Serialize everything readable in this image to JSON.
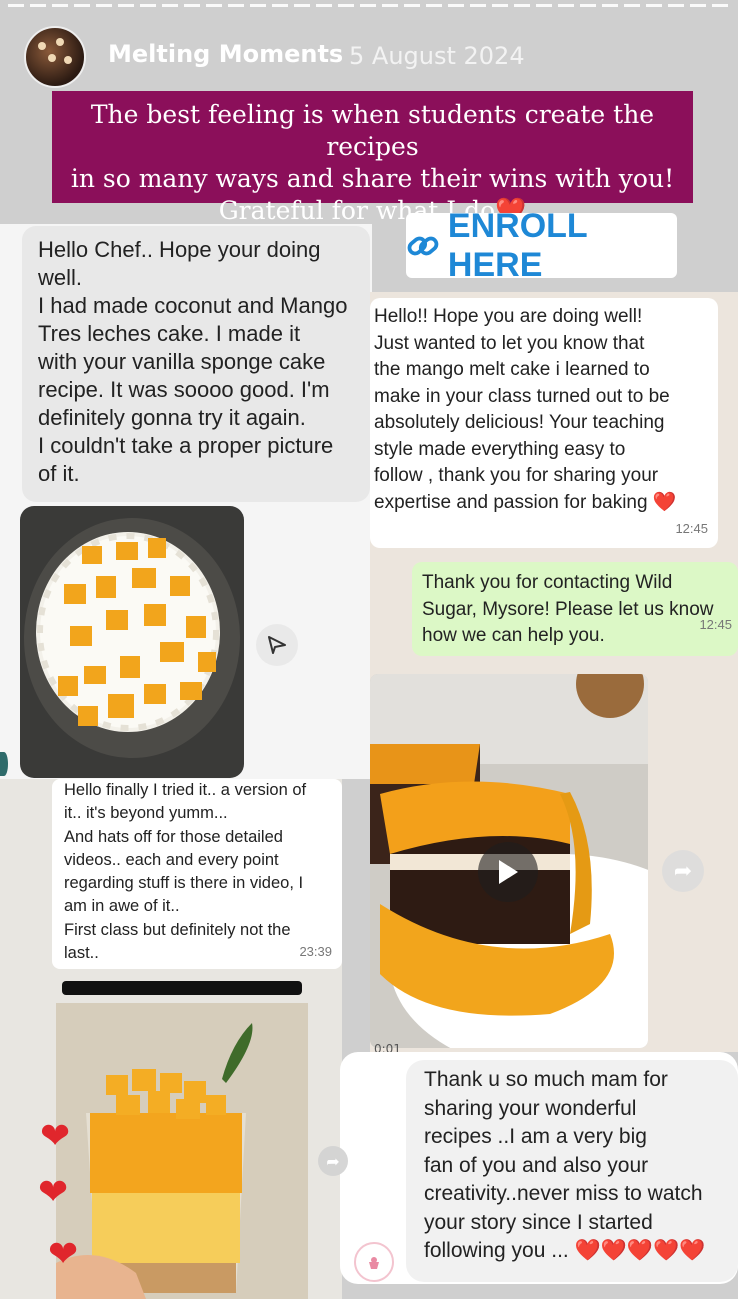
{
  "story": {
    "account_name": "Melting Moments",
    "date": "5 August 2024",
    "banner_lines": [
      "The best feeling is when students create the recipes",
      "in so many ways and share their wins with you!",
      "Grateful for what I do"
    ],
    "banner_heart": "❤️"
  },
  "enroll": {
    "label": "ENROLL HERE",
    "icon": "link-icon"
  },
  "messages": {
    "chef_msg": [
      "Hello Chef.. Hope your doing",
      "well.",
      "I had made coconut and Mango",
      "Tres leches cake. I made it",
      "with your vanilla sponge cake",
      "recipe. It was soooo good. I'm",
      "definitely gonna try it again.",
      "I couldn't take a proper picture",
      "of it."
    ],
    "mango_melt_msg": [
      "Hello!! Hope you are doing well!",
      "Just wanted to let you know that",
      "the mango melt cake i learned to",
      "make in your class turned out to be",
      "absolutely delicious! Your teaching",
      "style made everything easy to",
      "follow , thank you for sharing your",
      "expertise and passion for baking ❤️"
    ],
    "mango_melt_time": "12:45",
    "auto_reply": [
      "Thank you for contacting Wild",
      "Sugar, Mysore! Please let us know",
      "how we can help you."
    ],
    "auto_reply_time": "12:45",
    "tried_msg": [
      "Hello finally I tried it.. a version of",
      "it.. it's beyond yumm...",
      "And hats off for those detailed",
      "videos.. each and every point",
      "regarding stuff is there in video,  I",
      "am in awe of it..",
      "First class but definitely not the",
      "last.."
    ],
    "tried_time": "23:39",
    "fan_msg": [
      "Thank u so much mam for",
      "sharing your wonderful",
      "recipes ..I am a very big",
      "fan of you and also your",
      "creativity..never miss to watch",
      "your story since I started",
      "following you ... ❤️❤️❤️❤️❤️"
    ],
    "video_label": "0:01"
  },
  "colors": {
    "banner": "#8b0f5a",
    "enroll_text": "#1e88d6",
    "chat_bg": "#ece5dd",
    "outgoing_bubble": "#dcf8c6",
    "mango": "#f2a51c"
  }
}
